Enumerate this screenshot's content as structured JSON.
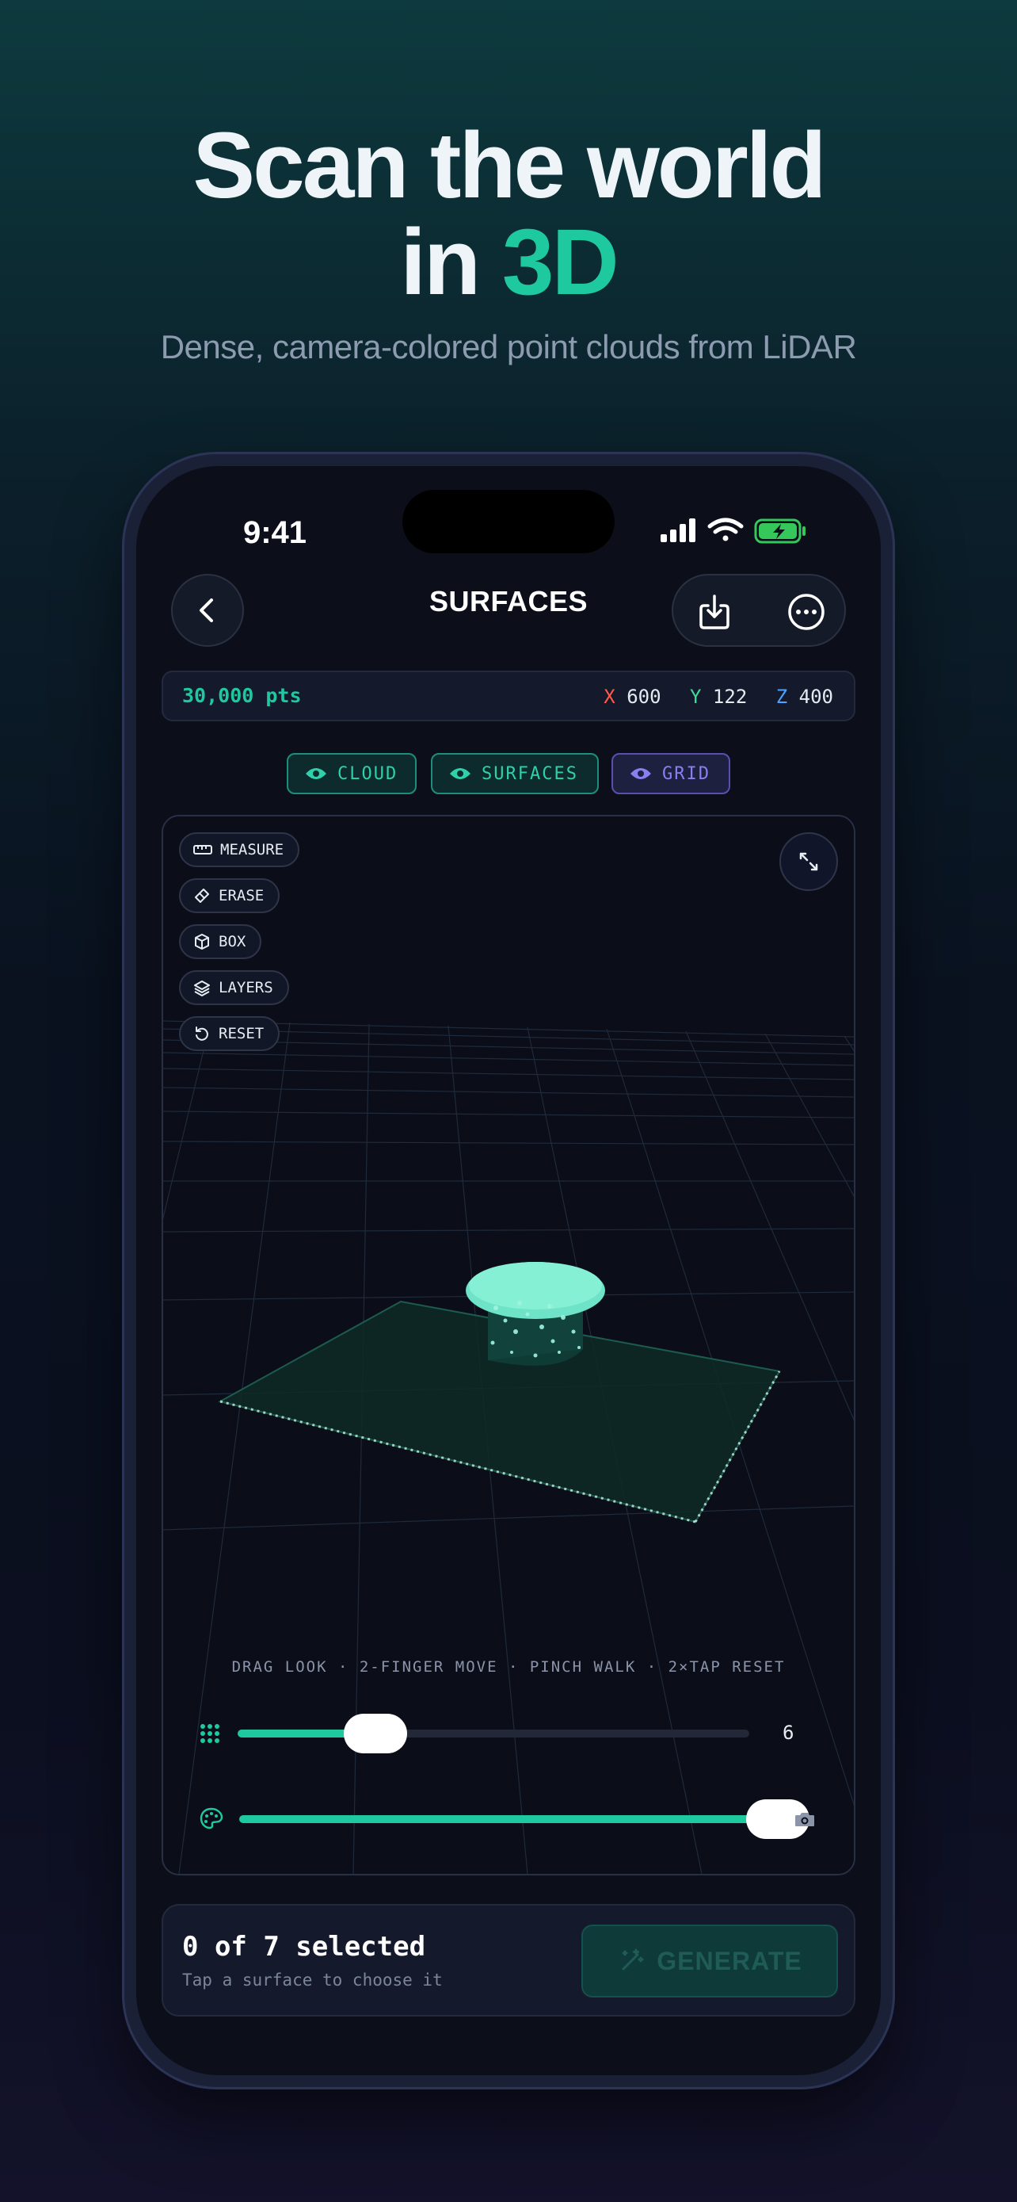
{
  "hero": {
    "title_line1": "Scan the world",
    "title_line2_prefix": "in ",
    "title_line2_accent": "3D",
    "subtitle": "Dense, camera-colored point clouds from LiDAR"
  },
  "status_bar": {
    "time": "9:41"
  },
  "nav": {
    "title": "SURFACES"
  },
  "stats": {
    "points": "30,000 pts",
    "x_label": "X",
    "x_value": "600",
    "y_label": "Y",
    "y_value": "122",
    "z_label": "Z",
    "z_value": "400"
  },
  "toggles": [
    {
      "label": "CLOUD",
      "icon": "eye-icon",
      "color": "#2fd1ab"
    },
    {
      "label": "SURFACES",
      "icon": "eye-icon",
      "color": "#2fd1ab"
    },
    {
      "label": "GRID",
      "icon": "eye-icon",
      "color": "#8a7ff0"
    }
  ],
  "tools": [
    {
      "label": "MEASURE",
      "icon": "ruler-icon"
    },
    {
      "label": "ERASE",
      "icon": "eraser-icon"
    },
    {
      "label": "BOX",
      "icon": "cube-icon"
    },
    {
      "label": "LAYERS",
      "icon": "layers-icon"
    },
    {
      "label": "RESET",
      "icon": "reset-icon"
    }
  ],
  "hint": "DRAG LOOK · 2-FINGER MOVE · PINCH WALK · 2×TAP RESET",
  "sliders": {
    "point_size": {
      "icon": "grid-dots-icon",
      "value": "6",
      "fraction": 0.27
    },
    "color_blend": {
      "icon": "palette-icon",
      "end_icon": "camera-icon",
      "fraction": 1.0
    }
  },
  "selection": {
    "title": "0 of 7 selected",
    "subtitle": "Tap a surface to choose it",
    "generate_label": "GENERATE"
  },
  "colors": {
    "accent": "#1ec9a0",
    "x_axis": "#ff5a4a",
    "y_axis": "#3ddc97",
    "z_axis": "#4da3ff"
  }
}
